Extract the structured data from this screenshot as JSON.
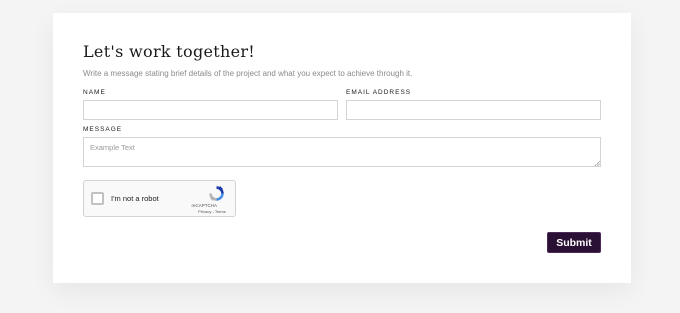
{
  "form": {
    "title": "Let's work together!",
    "intro": "Write a message stating brief details of the project and what you expect to achieve through it.",
    "name_label": "NAME",
    "name_value": "",
    "email_label": "EMAIL ADDRESS",
    "email_value": "",
    "message_label": "MESSAGE",
    "message_placeholder": "Example Text",
    "submit_label": "Submit"
  },
  "captcha": {
    "label": "I'm not a robot",
    "brand": "reCAPTCHA",
    "links": "Privacy - Terms",
    "checked": false
  },
  "colors": {
    "submit_bg": "#2a1034",
    "recaptcha_blue": "#4a90e2",
    "recaptcha_grey": "#b5b5b5"
  }
}
